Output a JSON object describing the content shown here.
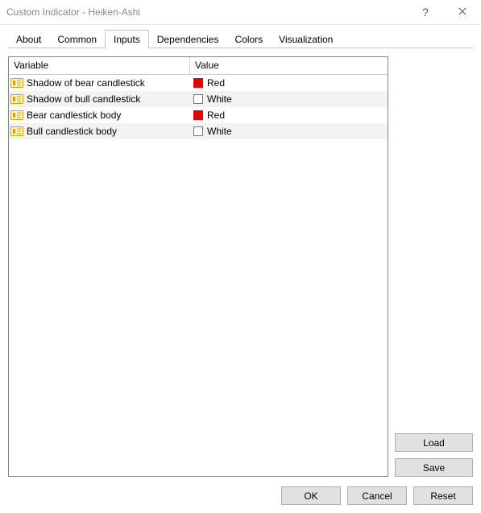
{
  "window": {
    "title": "Custom Indicator - Heiken-Ashi"
  },
  "tabs": {
    "items": [
      {
        "label": "About"
      },
      {
        "label": "Common"
      },
      {
        "label": "Inputs"
      },
      {
        "label": "Dependencies"
      },
      {
        "label": "Colors"
      },
      {
        "label": "Visualization"
      }
    ],
    "active_index": 2
  },
  "table": {
    "headers": {
      "variable": "Variable",
      "value": "Value"
    },
    "rows": [
      {
        "variable": "Shadow of bear candlestick",
        "color_key": "red",
        "color_label": "Red"
      },
      {
        "variable": "Shadow of bull candlestick",
        "color_key": "white",
        "color_label": "White"
      },
      {
        "variable": "Bear candlestick body",
        "color_key": "red",
        "color_label": "Red"
      },
      {
        "variable": "Bull candlestick body",
        "color_key": "white",
        "color_label": "White"
      }
    ]
  },
  "side_buttons": {
    "load": "Load",
    "save": "Save"
  },
  "footer_buttons": {
    "ok": "OK",
    "cancel": "Cancel",
    "reset": "Reset"
  },
  "colors": {
    "red": "#e60000",
    "white": "#ffffff"
  }
}
